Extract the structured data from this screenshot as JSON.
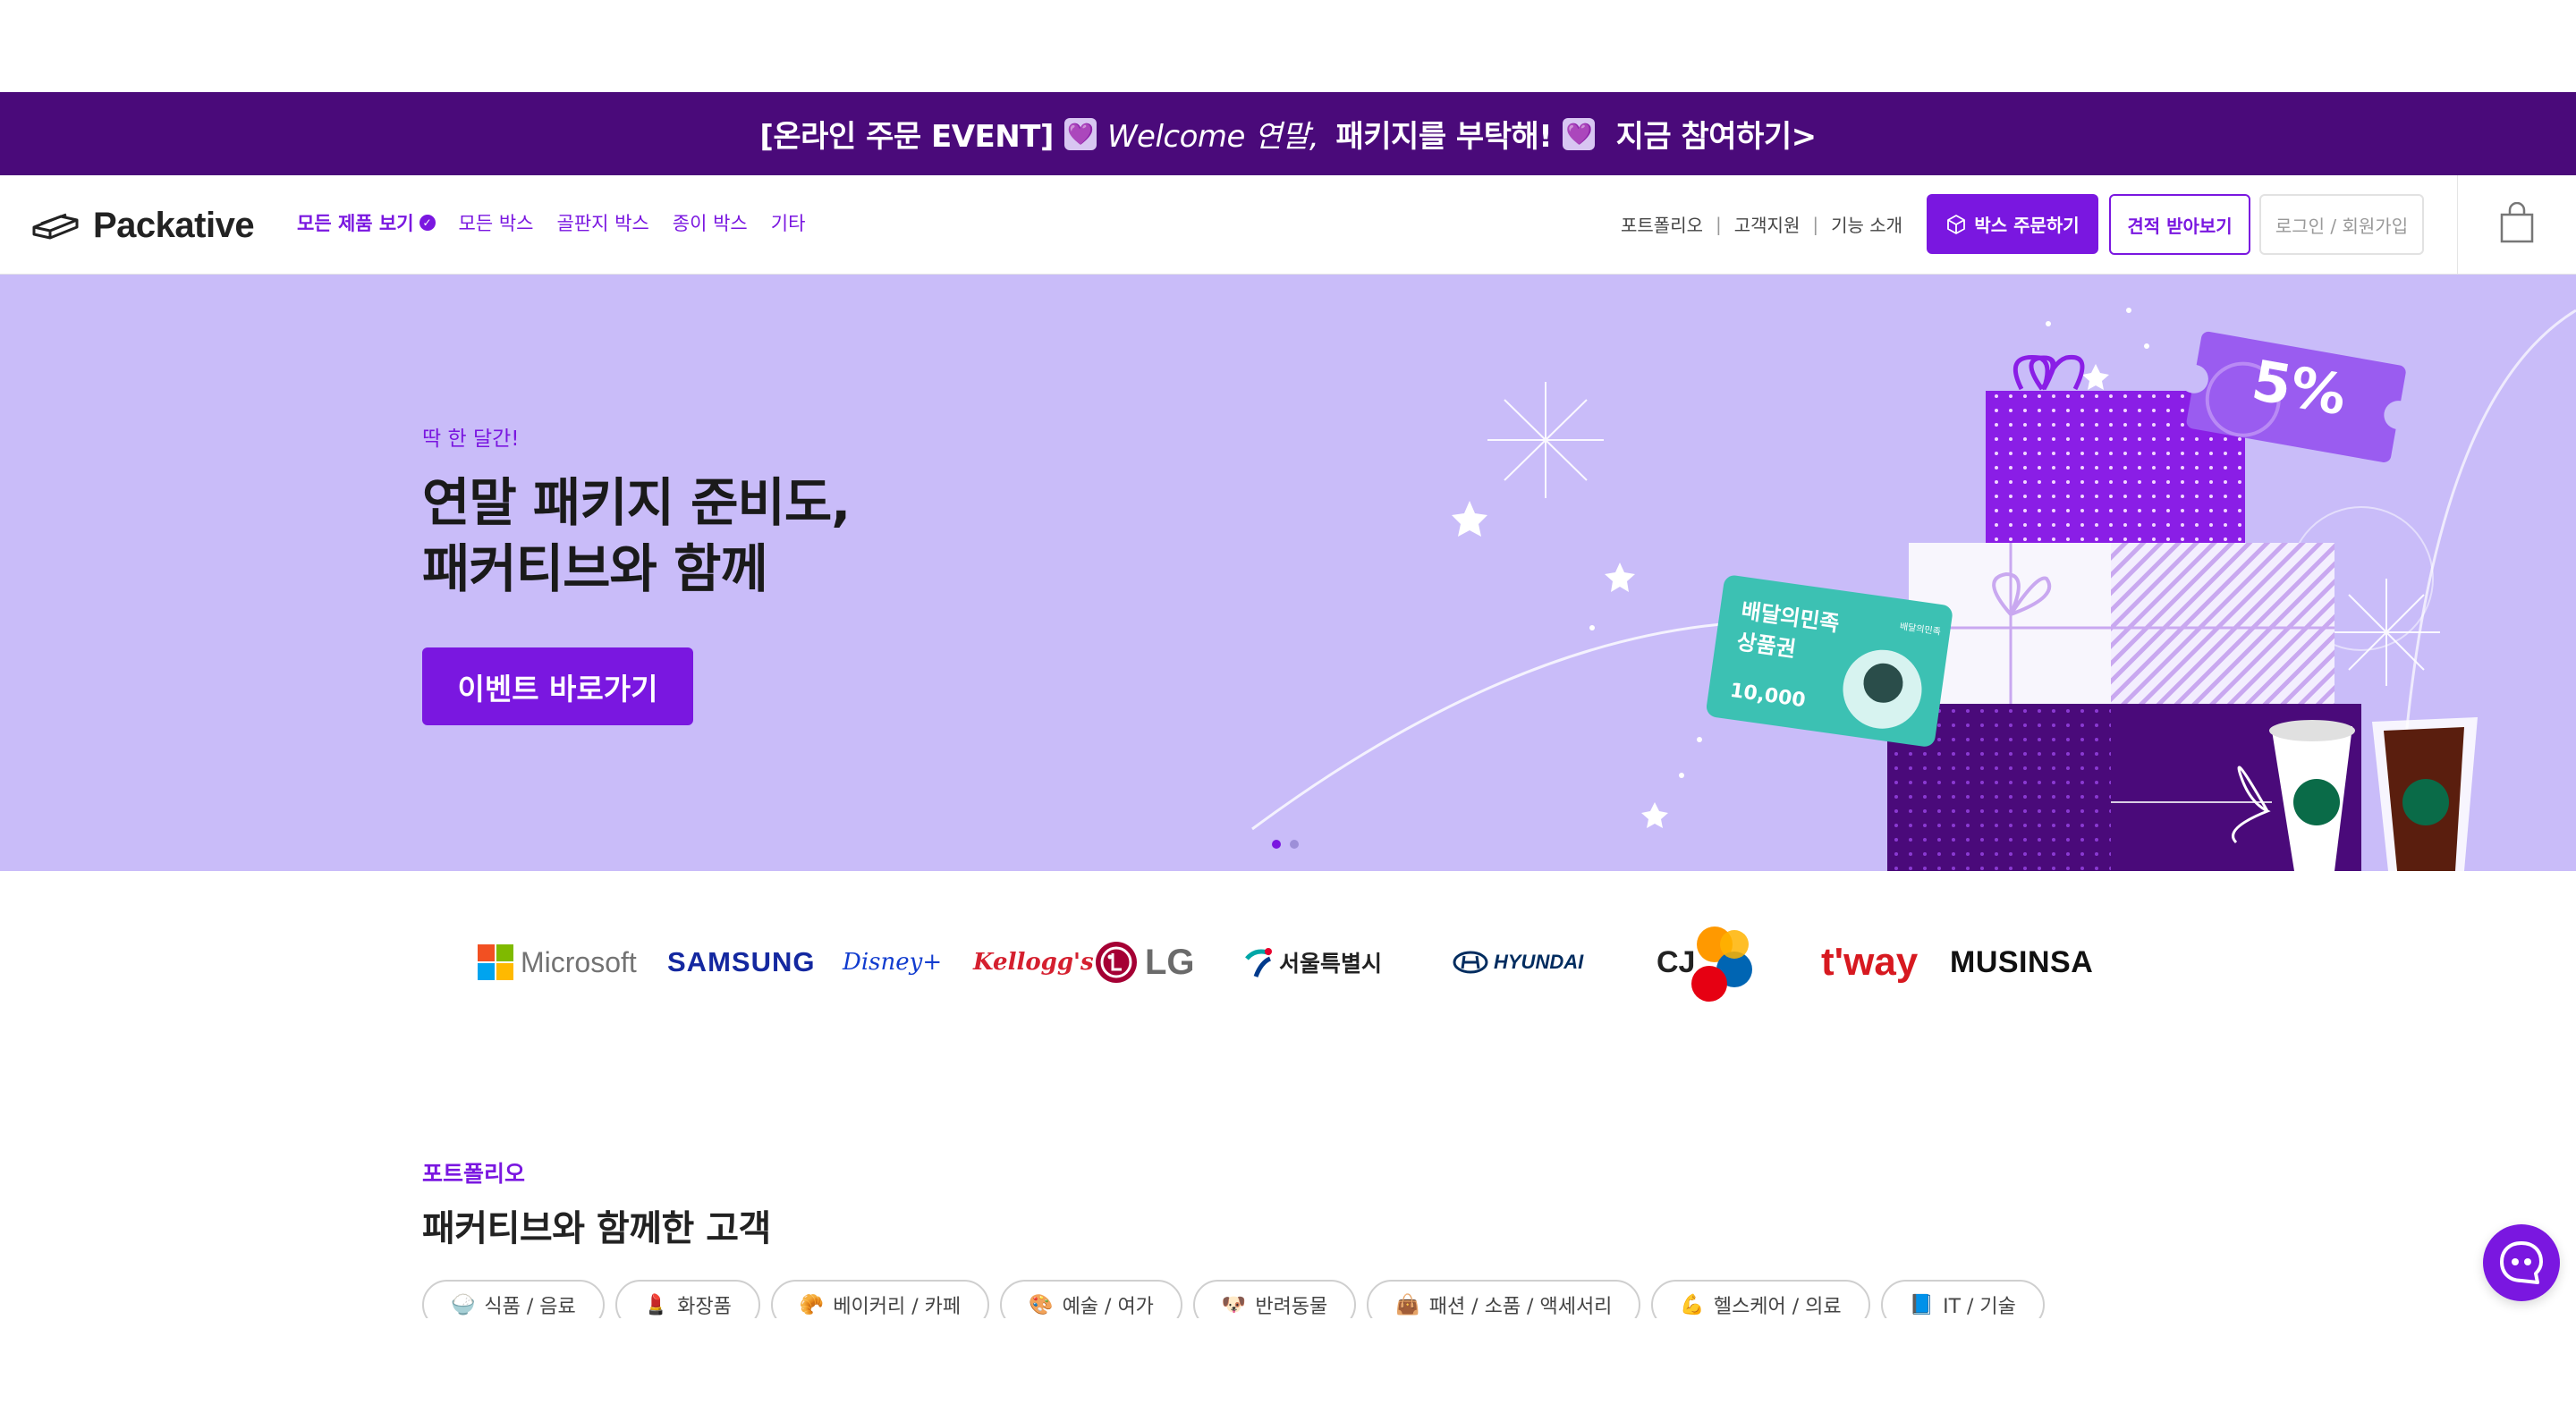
{
  "event_banner": {
    "part1": "[온라인 주문 EVENT]",
    "heart": "💜",
    "welcome": "Welcome 연말,",
    "part2": " 패키지를 부탁해!",
    "part3": " 지금 참여하기>"
  },
  "header": {
    "logo_text": "Packative",
    "nav": [
      "모든 제품 보기",
      "모든 박스",
      "골판지 박스",
      "종이 박스",
      "기타"
    ],
    "util_links": [
      "포트폴리오",
      "고객지원",
      "기능 소개"
    ],
    "util_separator": "|",
    "order_button": "박스 주문하기",
    "quote_button": "견적 받아보기",
    "login_button": "로그인 / 회원가입"
  },
  "hero": {
    "eyebrow": "딱 한 달간!",
    "title_line1": "연말 패키지 준비도,",
    "title_line2": "패커티브와 함께",
    "cta": "이벤트 바로가기",
    "coupon_text": "5%",
    "giftcard_title_line1": "배달의민족",
    "giftcard_title_line2": "상품권",
    "giftcard_brand": "배달의민족",
    "giftcard_amount": "10,000",
    "slide_count": 2,
    "active_slide": 1
  },
  "brands": [
    "Microsoft",
    "SAMSUNG",
    "Disney+",
    "Kellogg's",
    "LG",
    "서울특별시",
    "HYUNDAI",
    "CJ",
    "t'way",
    "MUSINSA"
  ],
  "portfolio": {
    "eyebrow": "포트폴리오",
    "title": "패커티브와 함께한 고객",
    "categories": [
      {
        "icon": "🍚",
        "label": "식품 / 음료"
      },
      {
        "icon": "💄",
        "label": "화장품"
      },
      {
        "icon": "🥐",
        "label": "베이커리 / 카페"
      },
      {
        "icon": "🎨",
        "label": "예술 / 여가"
      },
      {
        "icon": "🐶",
        "label": "반려동물"
      },
      {
        "icon": "👜",
        "label": "패션 / 소품 / 액세서리"
      },
      {
        "icon": "💪",
        "label": "헬스케어 / 의료"
      },
      {
        "icon": "📘",
        "label": "IT / 기술"
      }
    ]
  },
  "colors": {
    "primary": "#7a17e0",
    "banner_bg": "#4a0a7a",
    "hero_bg": "#c9bcf9"
  }
}
